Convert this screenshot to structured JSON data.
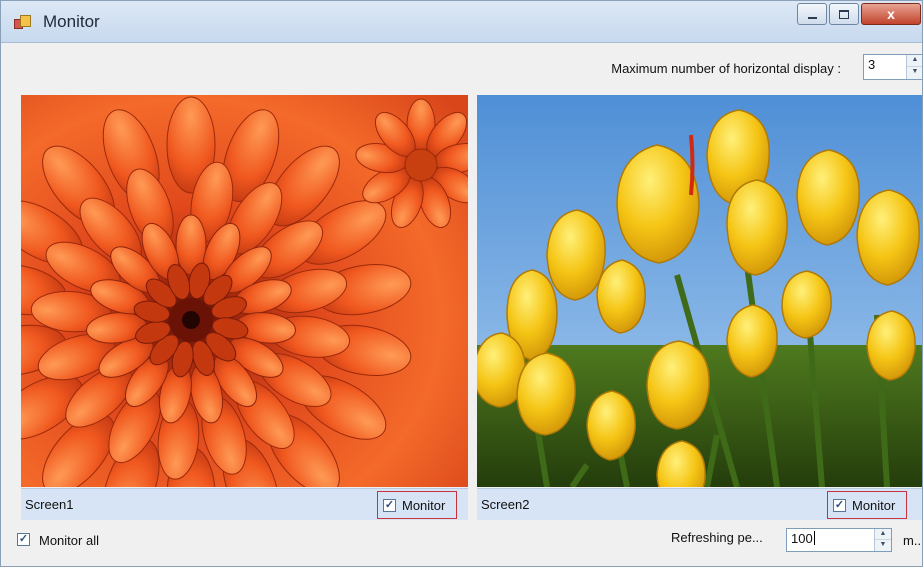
{
  "window": {
    "title": "Monitor",
    "icon": "app-icon",
    "controls": {
      "minimize": "minimize",
      "maximize": "maximize",
      "close": "x"
    }
  },
  "toolbar": {
    "max_horizontal_label": "Maximum number of horizontal display :",
    "max_horizontal_value": "3"
  },
  "screens": [
    {
      "name": "Screen1",
      "monitor_label": "Monitor",
      "monitor_checked": true,
      "image": "orange-chrysanthemum"
    },
    {
      "name": "Screen2",
      "monitor_label": "Monitor",
      "monitor_checked": true,
      "image": "yellow-tulips"
    }
  ],
  "footer": {
    "monitor_all_label": "Monitor all",
    "monitor_all_checked": true,
    "refresh_label": "Refreshing pe...",
    "refresh_value": "100",
    "refresh_unit": "m..."
  },
  "colors": {
    "highlight_border": "#c8323a",
    "caption_bg": "#d6e4f5"
  }
}
